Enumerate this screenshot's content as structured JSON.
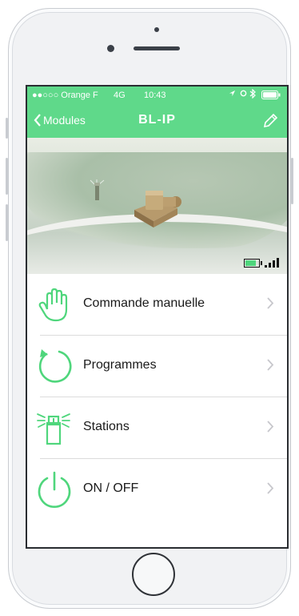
{
  "status_bar": {
    "carrier": "●●○○○ Orange F",
    "network": "4G",
    "time": "10:43",
    "battery_level": 1.0
  },
  "nav": {
    "back_label": "Modules",
    "title": "BL-IP",
    "edit_icon": "pencil-icon"
  },
  "device_status": {
    "battery_level": 0.85,
    "signal_bars": 4
  },
  "menu": {
    "items": [
      {
        "label": "Commande manuelle",
        "icon": "hand-icon"
      },
      {
        "label": "Programmes",
        "icon": "cycle-icon"
      },
      {
        "label": "Stations",
        "icon": "sprinkler-station-icon"
      },
      {
        "label": "ON / OFF",
        "icon": "power-icon"
      }
    ]
  },
  "colors": {
    "accent": "#5fd98a",
    "icon": "#4fd67c"
  }
}
